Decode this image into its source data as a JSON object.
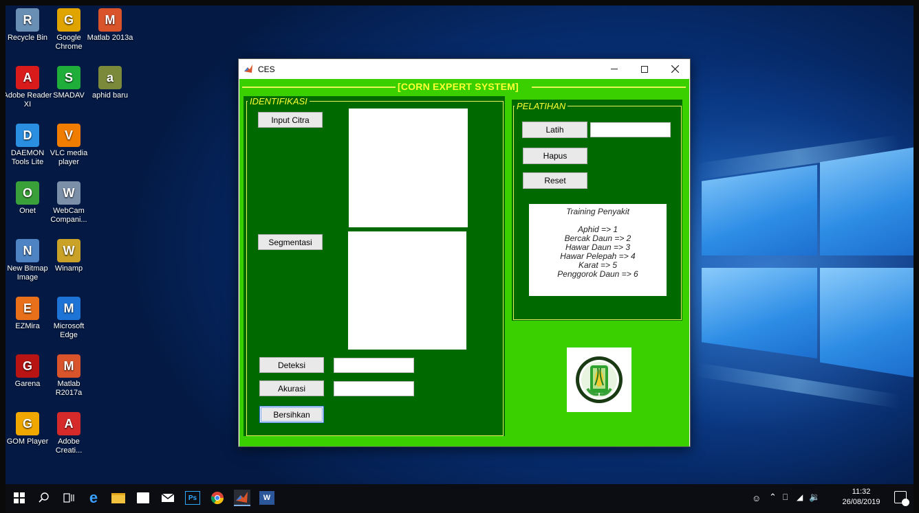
{
  "desktop": {
    "icons": [
      {
        "label": "Recycle Bin",
        "icon": "recycle-bin-icon",
        "color": "#6a8fb5"
      },
      {
        "label": "Google Chrome",
        "icon": "chrome-icon",
        "color": "#e0a400"
      },
      {
        "label": "Matlab 2013a",
        "icon": "matlab-icon",
        "color": "#d9542b"
      },
      {
        "label": "Adobe Reader XI",
        "icon": "adobe-reader-icon",
        "color": "#d91b1b"
      },
      {
        "label": "SMADAV",
        "icon": "smadav-icon",
        "color": "#1fae3a"
      },
      {
        "label": "aphid baru",
        "icon": "folder-icon",
        "color": "#7a8a3a"
      },
      {
        "label": "DAEMON Tools Lite",
        "icon": "daemon-tools-icon",
        "color": "#2a8fe0"
      },
      {
        "label": "VLC media player",
        "icon": "vlc-icon",
        "color": "#f07d00"
      },
      {
        "label": "Onet",
        "icon": "onet-icon",
        "color": "#3aa13a"
      },
      {
        "label": "WebCam Compani...",
        "icon": "webcam-icon",
        "color": "#7b8fa8"
      },
      {
        "label": "New Bitmap Image",
        "icon": "bitmap-icon",
        "color": "#4f84c4"
      },
      {
        "label": "Winamp",
        "icon": "winamp-icon",
        "color": "#c9a227"
      },
      {
        "label": "EZMira",
        "icon": "ezmira-icon",
        "color": "#e8701a"
      },
      {
        "label": "Microsoft Edge",
        "icon": "edge-icon",
        "color": "#1e74d6"
      },
      {
        "label": "Garena",
        "icon": "garena-icon",
        "color": "#b81414"
      },
      {
        "label": "Matlab R2017a",
        "icon": "matlab-icon",
        "color": "#d9542b"
      },
      {
        "label": "GOM Player",
        "icon": "gom-player-icon",
        "color": "#f0a800"
      },
      {
        "label": "Adobe Creati...",
        "icon": "adobe-cc-icon",
        "color": "#d62a2a"
      }
    ]
  },
  "window": {
    "title": "CES",
    "header_title": "[CORN EXPERT SYSTEM]",
    "identifikasi": {
      "label": "IDENTIFIKASI",
      "input_citra": "Input Citra",
      "segmentasi": "Segmentasi",
      "deteksi": "Deteksi",
      "deteksi_value": "",
      "akurasi": "Akurasi",
      "akurasi_value": "",
      "bersihkan": "Bersihkan"
    },
    "pelatihan": {
      "label": "PELATIHAN",
      "latih": "Latih",
      "latih_value": "",
      "hapus": "Hapus",
      "reset": "Reset",
      "info_title": "Training Penyakit",
      "info_lines": [
        "Aphid => 1",
        "Bercak Daun => 2",
        "Hawar Daun => 3",
        "Hawar Pelepah => 4",
        "Karat => 5",
        "Penggorok Daun => 6"
      ]
    },
    "colors": {
      "client_bg": "#3ad000",
      "panel_bg": "#006a00",
      "frame": "#e9f55a",
      "title_text": "#ffff33"
    }
  },
  "taskbar": {
    "time": "11:32",
    "date": "26/08/2019"
  }
}
